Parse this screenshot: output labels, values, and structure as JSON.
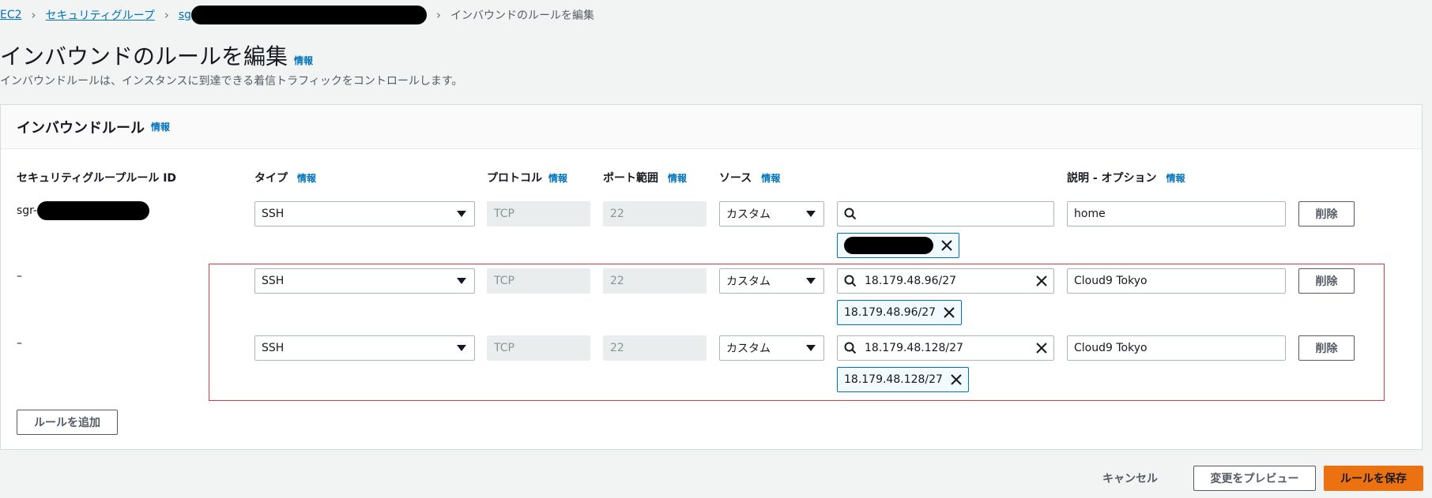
{
  "breadcrumb": {
    "ec2": "EC2",
    "security_groups": "セキュリティグループ",
    "sg_prefix": "sg",
    "current": "インバウンドのルールを編集"
  },
  "header": {
    "title": "インバウンドのルールを編集",
    "info": "情報",
    "description": "インバウンドルールは、インスタンスに到達できる着信トラフィックをコントロールします。"
  },
  "panel": {
    "title": "インバウンドルール",
    "info": "情報",
    "columns": {
      "rule_id": "セキュリティグループルール ID",
      "type": "タイプ",
      "protocol": "プロトコル",
      "port_range": "ポート範囲",
      "source": "ソース",
      "description": "説明 - オプション"
    },
    "rows": [
      {
        "rule_id": "sgr-",
        "type": "SSH",
        "protocol": "TCP",
        "port": "22",
        "source_type": "カスタム",
        "source_search": "",
        "source_token": "",
        "description": "home",
        "delete": "削除"
      },
      {
        "rule_id": "–",
        "type": "SSH",
        "protocol": "TCP",
        "port": "22",
        "source_type": "カスタム",
        "source_search": "18.179.48.96/27",
        "source_token": "18.179.48.96/27",
        "description": "Cloud9 Tokyo",
        "delete": "削除"
      },
      {
        "rule_id": "–",
        "type": "SSH",
        "protocol": "TCP",
        "port": "22",
        "source_type": "カスタム",
        "source_search": "18.179.48.128/27",
        "source_token": "18.179.48.128/27",
        "description": "Cloud9 Tokyo",
        "delete": "削除"
      }
    ],
    "add_rule": "ルールを追加"
  },
  "footer": {
    "cancel": "キャンセル",
    "preview": "変更をプレビュー",
    "save": "ルールを保存"
  },
  "colors": {
    "link": "#0073bb",
    "primary": "#ec7211",
    "highlight": "#e0383e"
  }
}
